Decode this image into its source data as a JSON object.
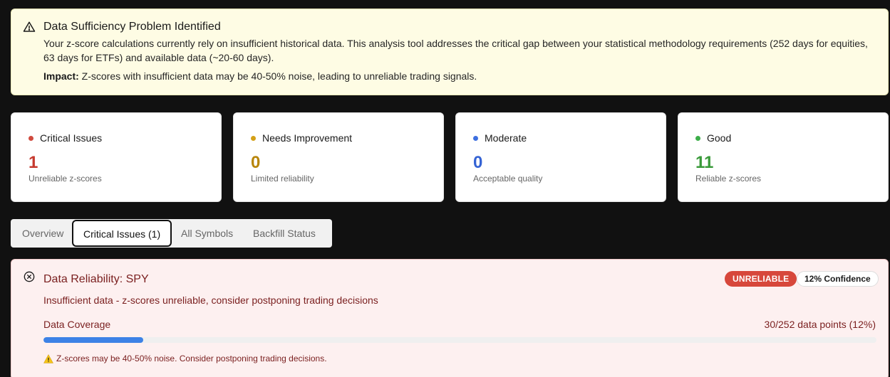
{
  "alert": {
    "icon": "warning-triangle-icon",
    "title": "Data Sufficiency Problem Identified",
    "body": "Your z-score calculations currently rely on insufficient historical data. This analysis tool addresses the critical gap between your statistical methodology requirements (252 days for equities, 63 days for ETFs) and available data (~20-60 days).",
    "impact_label": "Impact:",
    "impact_text": " Z-scores with insufficient data may be 40-50% noise, leading to unreliable trading signals."
  },
  "cards": [
    {
      "label": "Critical Issues",
      "value": "1",
      "sub": "Unreliable z-scores",
      "color": "#c63a2f"
    },
    {
      "label": "Needs Improvement",
      "value": "0",
      "sub": "Limited reliability",
      "color": "#b8860b"
    },
    {
      "label": "Moderate",
      "value": "0",
      "sub": "Acceptable quality",
      "color": "#3563d4"
    },
    {
      "label": "Good",
      "value": "11",
      "sub": "Reliable z-scores",
      "color": "#3a9a3a"
    }
  ],
  "tabs": {
    "overview": "Overview",
    "critical": "Critical Issues (1)",
    "all_symbols": "All Symbols",
    "backfill": "Backfill Status",
    "active": "critical"
  },
  "panel": {
    "icon": "x-circle-icon",
    "title": "Data Reliability: SPY",
    "badge": "UNRELIABLE",
    "confidence": "12% Confidence",
    "description": "Insufficient data - z-scores unreliable, consider postponing trading decisions",
    "coverage_label": "Data Coverage",
    "coverage_value": "30/252 data points (12%)",
    "coverage_fraction": 0.12,
    "warning": "Z-scores may be 40-50% noise. Consider postponing trading decisions."
  },
  "colors": {
    "alert_bg": "#fefce4",
    "panel_bg": "#fdf0f0",
    "badge_red": "#d7473b",
    "progress_blue": "#3d82e6"
  }
}
